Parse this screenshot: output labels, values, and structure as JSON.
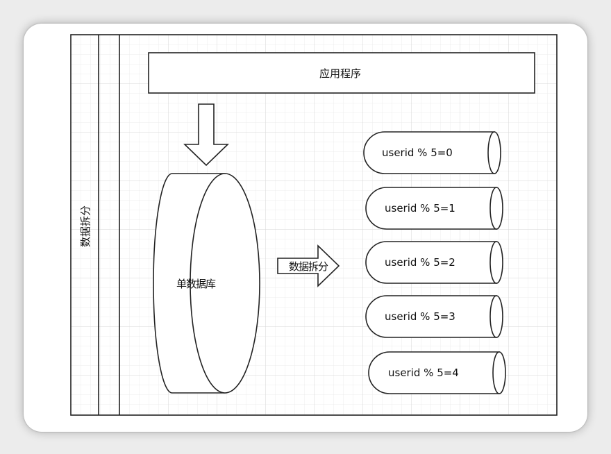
{
  "app": {
    "top_box_label": "应用程序",
    "swimlane_label": "数据拆分",
    "source_db_label": "单数据库",
    "split_arrow_label": "数据拆分",
    "shards": [
      "userid % 5=0",
      "userid % 5=1",
      "userid % 5=2",
      "userid % 5=3",
      "userid % 5=4"
    ]
  },
  "colors": {
    "stroke": "#222222",
    "grid_minor": "#ececec",
    "grid_major": "#d4d4d4",
    "canvas": "#ffffff",
    "page_background": "#ececec"
  }
}
